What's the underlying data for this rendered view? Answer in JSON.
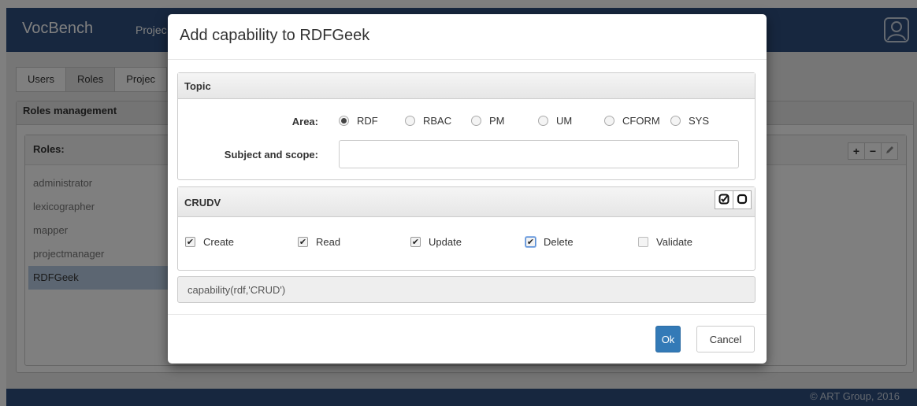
{
  "navbar": {
    "brand": "VocBench",
    "link": "Projec"
  },
  "tabs": [
    {
      "label": "Users"
    },
    {
      "label": "Roles"
    },
    {
      "label": "Projec"
    }
  ],
  "panel": {
    "title": "Roles management"
  },
  "roles": {
    "heading": "Roles:",
    "items": [
      "administrator",
      "lexicographer",
      "mapper",
      "projectmanager",
      "RDFGeek"
    ],
    "selected": "RDFGeek"
  },
  "footer": {
    "copyright": "© ART Group, 2016"
  },
  "modal": {
    "title": "Add capability to RDFGeek",
    "topic": {
      "heading": "Topic",
      "area_label": "Area:",
      "areas": [
        "RDF",
        "RBAC",
        "PM",
        "UM",
        "CFORM",
        "SYS"
      ],
      "area_selected": "RDF",
      "subject_label": "Subject and scope:",
      "subject_value": ""
    },
    "crudv": {
      "heading": "CRUDV",
      "options": [
        {
          "label": "Create",
          "checked": true
        },
        {
          "label": "Read",
          "checked": true
        },
        {
          "label": "Update",
          "checked": true
        },
        {
          "label": "Delete",
          "checked": true
        },
        {
          "label": "Validate",
          "checked": false
        }
      ]
    },
    "result": "capability(rdf,'CRUD')",
    "ok_label": "Ok",
    "cancel_label": "Cancel"
  },
  "colors": {
    "navbar": "#2e4e7e",
    "primary": "#337ab7",
    "selected_row": "#b8cce4"
  }
}
